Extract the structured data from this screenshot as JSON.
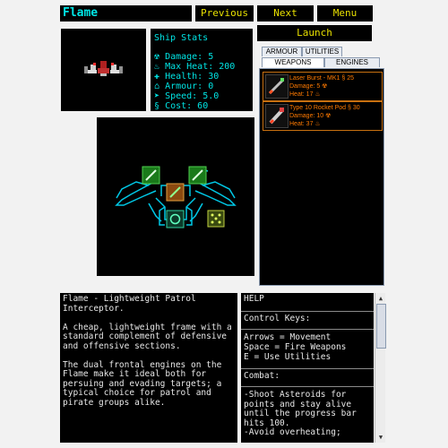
{
  "header": {
    "title": "Flame",
    "previous_label": "Previous",
    "next_label": "Next",
    "menu_label": "Menu",
    "launch_label": "Launch"
  },
  "stats": {
    "heading": "Ship Stats",
    "rows": [
      {
        "icon": "radiation-icon",
        "label": "Damage: 5"
      },
      {
        "icon": "flame-icon",
        "label": "Max Heat: 200"
      },
      {
        "icon": "health-icon",
        "label": "Health: 30"
      },
      {
        "icon": "shield-icon",
        "label": "Armour: 0"
      },
      {
        "icon": "speed-icon",
        "label": "Speed: 5.0"
      },
      {
        "icon": "cost-icon",
        "label": "Cost: 60"
      }
    ],
    "glyphs": [
      "☢",
      "♨",
      "✚",
      "⌂",
      "➤",
      "§"
    ]
  },
  "tabs": {
    "armour": "ARMOUR",
    "utilities": "UTILITIES",
    "weapons": "WEAPONS",
    "engines": "ENGINES",
    "selected": "WEAPONS"
  },
  "items": [
    {
      "name": "Laser Burst - MK1 § 25",
      "damage": "Damage: 5 ☢",
      "heat": "Heat: 17 ♨"
    },
    {
      "name": "Type 10 Rocket Pod § 30",
      "damage": "Damage: 10 ☢",
      "heat": "Heat: 37 ♨"
    }
  ],
  "description": {
    "paragraphs": [
      "Flame - Lightweight Patrol Interceptor.",
      "A cheap, lightweight frame with a standard complement of defensive and offensive sections.",
      "The dual frontal engines on the Flame make it ideal both for persuing and evading targets; a typical choice for patrol and pirate groups alike."
    ]
  },
  "help": {
    "title": "HELP",
    "controls_heading": "Control Keys:",
    "controls": [
      "Arrows = Movement",
      "Space = Fire Weapons",
      "E = Use Utilities"
    ],
    "combat_heading": "Combat:",
    "combat": [
      "-Shoot Asteroids for points and stay alive until the progress bar hits 100.",
      "-Avoid overheating;"
    ]
  },
  "colors": {
    "accent_text": "#00e5e5",
    "button_text": "#e8e000",
    "item_text": "#ff7a00",
    "item_border": "#c87010",
    "ship_outline": "#00c8e6",
    "weapon_slot": "#22aa22",
    "engine_slot": "#228844",
    "utility_slot": "#88aa22"
  }
}
